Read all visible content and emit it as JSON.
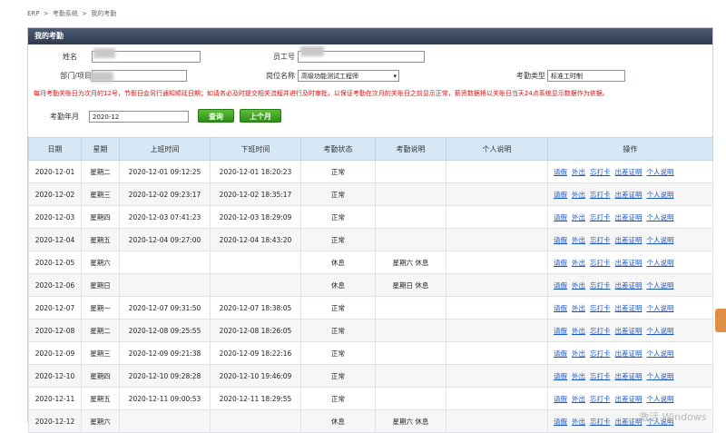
{
  "breadcrumb": [
    "ERP",
    ">",
    "考勤系统",
    ">",
    "我的考勤"
  ],
  "panel_title": "我的考勤",
  "filters": {
    "name_label": "姓名",
    "employee_no_label": "员工号",
    "dept_label": "部门/项目",
    "position_label": "岗位名称",
    "position_value": "高级功能测试工程师",
    "attendance_type_label": "考勤类型",
    "attendance_type_value": "标准工时制",
    "month_label": "考勤年月",
    "month_value": "2020-12",
    "query_button": "查询",
    "prev_month_button": "上个月"
  },
  "notice": "每月考勤关账日为次月的12号，节假日会另行通知顺延日期；如请务必及时提交相关流程并进行及时审批，以保证考勤在次月的关账日之前显示正常，薪资数据将以关账日当天24点系统显示数据作为依据。",
  "table": {
    "headers": [
      "日期",
      "星期",
      "上班时间",
      "下班时间",
      "考勤状态",
      "考勤说明",
      "个人说明",
      "操作"
    ],
    "ops": [
      "请假",
      "外出",
      "忘打卡",
      "出差证明",
      "个人说明"
    ],
    "rows": [
      {
        "date": "2020-12-01",
        "weekday": "星期二",
        "in": "2020-12-01 09:12:25",
        "out": "2020-12-01 18:20:23",
        "status": "正常",
        "note": "",
        "personal": ""
      },
      {
        "date": "2020-12-02",
        "weekday": "星期三",
        "in": "2020-12-02 09:23:17",
        "out": "2020-12-02 18:35:17",
        "status": "正常",
        "note": "",
        "personal": ""
      },
      {
        "date": "2020-12-03",
        "weekday": "星期四",
        "in": "2020-12-03 07:41:23",
        "out": "2020-12-03 18:29:09",
        "status": "正常",
        "note": "",
        "personal": ""
      },
      {
        "date": "2020-12-04",
        "weekday": "星期五",
        "in": "2020-12-04 09:27:00",
        "out": "2020-12-04 18:43:20",
        "status": "正常",
        "note": "",
        "personal": ""
      },
      {
        "date": "2020-12-05",
        "weekday": "星期六",
        "in": "",
        "out": "",
        "status": "休息",
        "note": "星期六 休息",
        "personal": ""
      },
      {
        "date": "2020-12-06",
        "weekday": "星期日",
        "in": "",
        "out": "",
        "status": "休息",
        "note": "星期日 休息",
        "personal": ""
      },
      {
        "date": "2020-12-07",
        "weekday": "星期一",
        "in": "2020-12-07 09:31:50",
        "out": "2020-12-07 18:38:05",
        "status": "正常",
        "note": "",
        "personal": ""
      },
      {
        "date": "2020-12-08",
        "weekday": "星期二",
        "in": "2020-12-08 09:25:55",
        "out": "2020-12-08 18:26:05",
        "status": "正常",
        "note": "",
        "personal": ""
      },
      {
        "date": "2020-12-09",
        "weekday": "星期三",
        "in": "2020-12-09 09:21:38",
        "out": "2020-12-09 18:22:16",
        "status": "正常",
        "note": "",
        "personal": ""
      },
      {
        "date": "2020-12-10",
        "weekday": "星期四",
        "in": "2020-12-10 09:28:28",
        "out": "2020-12-10 19:46:09",
        "status": "正常",
        "note": "",
        "personal": ""
      },
      {
        "date": "2020-12-11",
        "weekday": "星期五",
        "in": "2020-12-11 09:00:53",
        "out": "2020-12-11 18:29:55",
        "status": "正常",
        "note": "",
        "personal": ""
      },
      {
        "date": "2020-12-12",
        "weekday": "星期六",
        "in": "",
        "out": "",
        "status": "休息",
        "note": "星期六 休息",
        "personal": ""
      }
    ]
  },
  "watermark": "激活 Windows"
}
